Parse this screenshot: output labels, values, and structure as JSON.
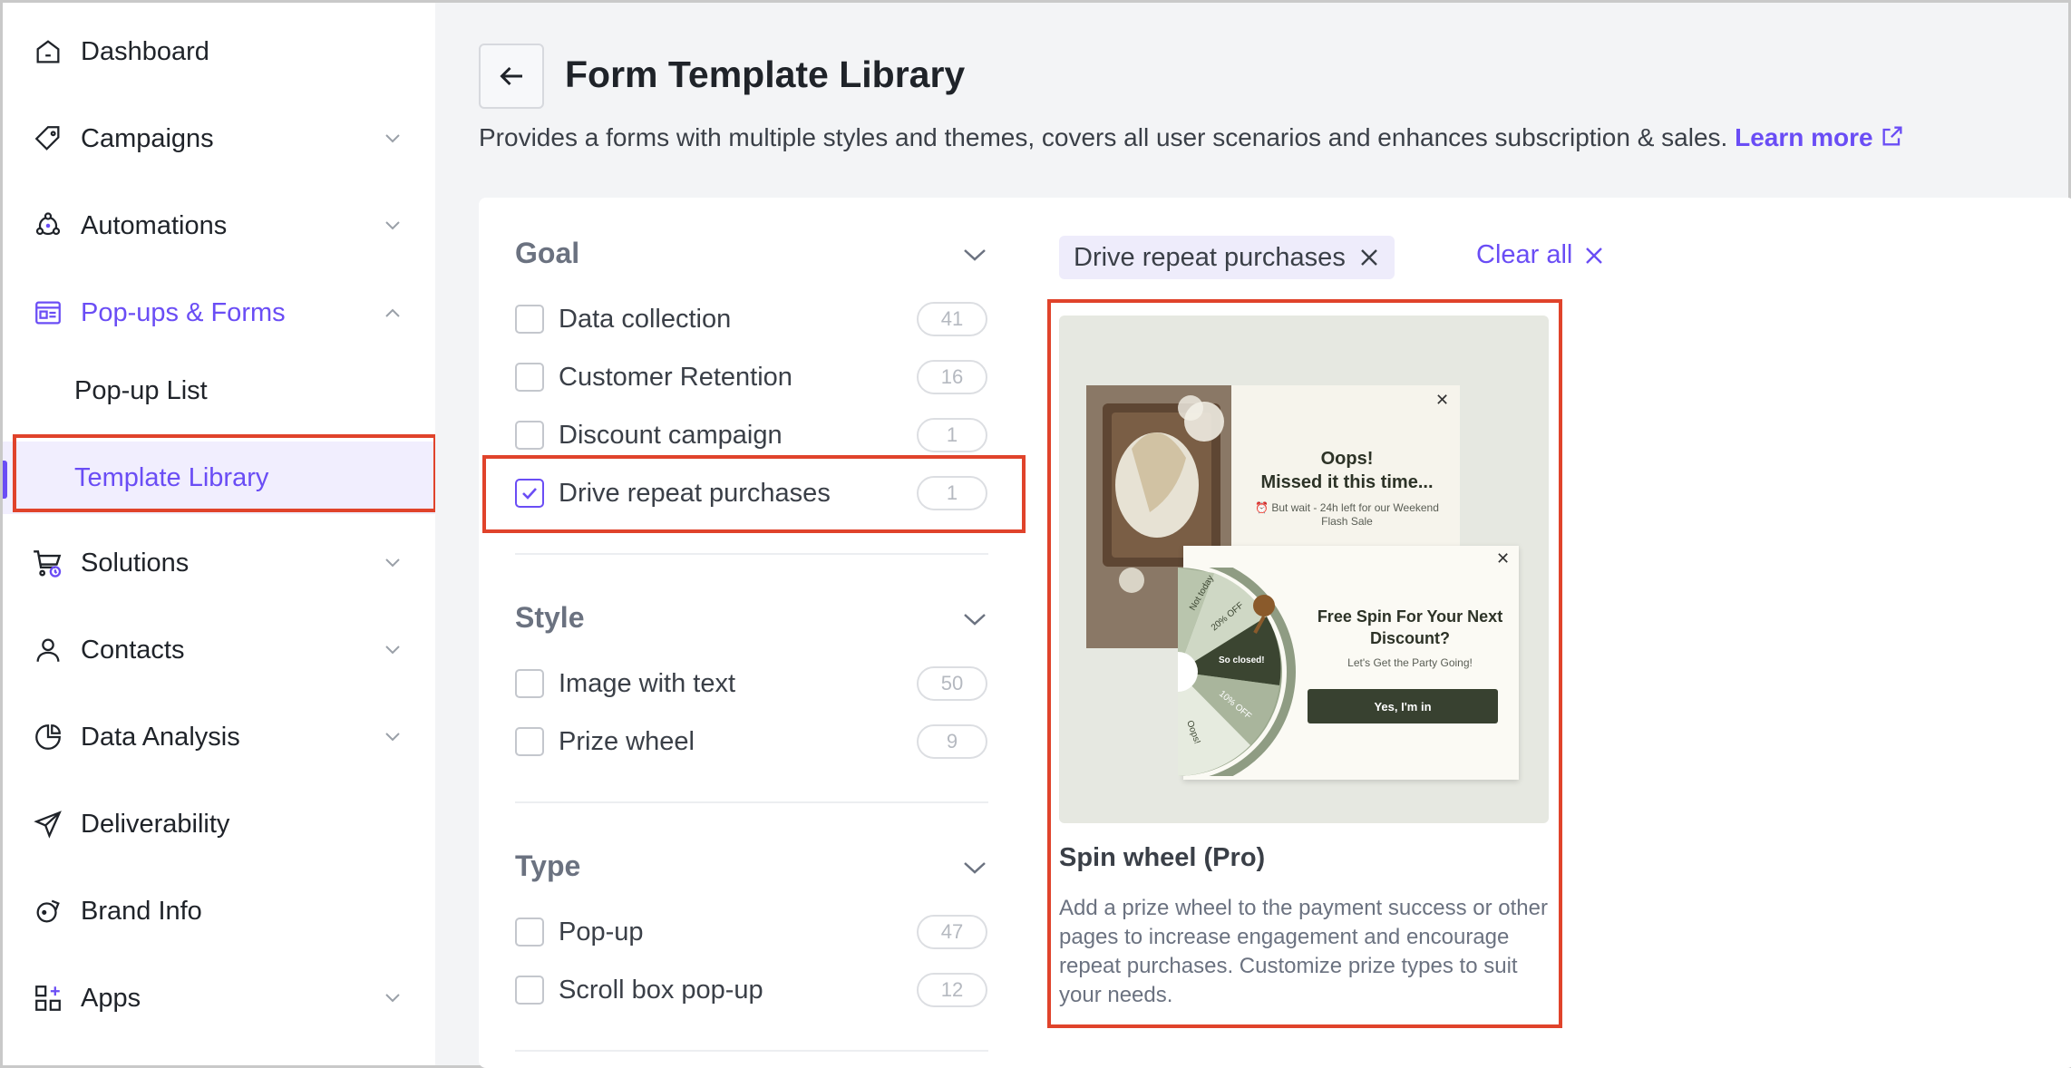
{
  "sidebar": {
    "items": [
      {
        "label": "Dashboard",
        "icon": "home-icon"
      },
      {
        "label": "Campaigns",
        "icon": "tag-icon"
      },
      {
        "label": "Automations",
        "icon": "automation-icon"
      },
      {
        "label": "Pop-ups & Forms",
        "icon": "form-icon"
      },
      {
        "label": "Solutions",
        "icon": "cart-icon"
      },
      {
        "label": "Contacts",
        "icon": "user-icon"
      },
      {
        "label": "Data Analysis",
        "icon": "pie-chart-icon"
      },
      {
        "label": "Deliverability",
        "icon": "send-icon"
      },
      {
        "label": "Brand Info",
        "icon": "brand-icon"
      },
      {
        "label": "Apps",
        "icon": "apps-icon"
      }
    ],
    "sub_items": [
      {
        "label": "Pop-up List"
      },
      {
        "label": "Template Library"
      }
    ]
  },
  "header": {
    "title": "Form Template Library",
    "description": "Provides a forms with multiple styles and themes, covers all user scenarios and enhances subscription & sales.",
    "learn_more": "Learn more"
  },
  "filters": {
    "goal": {
      "title": "Goal",
      "options": [
        {
          "label": "Data collection",
          "count": "41",
          "checked": false
        },
        {
          "label": "Customer Retention",
          "count": "16",
          "checked": false
        },
        {
          "label": "Discount campaign",
          "count": "1",
          "checked": false
        },
        {
          "label": "Drive repeat purchases",
          "count": "1",
          "checked": true
        }
      ]
    },
    "style": {
      "title": "Style",
      "options": [
        {
          "label": "Image with text",
          "count": "50",
          "checked": false
        },
        {
          "label": "Prize wheel",
          "count": "9",
          "checked": false
        }
      ]
    },
    "type": {
      "title": "Type",
      "options": [
        {
          "label": "Pop-up",
          "count": "47",
          "checked": false
        },
        {
          "label": "Scroll box pop-up",
          "count": "12",
          "checked": false
        }
      ]
    }
  },
  "active_filters": {
    "chip": "Drive repeat purchases",
    "clear_all": "Clear all"
  },
  "template": {
    "title": "Spin wheel (Pro)",
    "description": "Add a prize wheel to the payment success or other pages to increase engagement and encourage repeat purchases. Customize prize types to suit your needs.",
    "preview": {
      "popup1_heading": "Oops!\nMissed it this time...",
      "popup1_sub": "⏰ But wait - 24h left for our Weekend Flash Sale",
      "popup2_heading": "Free Spin For Your Next Discount?",
      "popup2_sub": "Let's Get the Party Going!",
      "popup2_button": "Yes, I'm in",
      "wheel_labels": [
        "Not today",
        "20% OFF",
        "So closed!",
        "10% OFF",
        "Oops!"
      ]
    }
  },
  "colors": {
    "accent": "#6a4df5",
    "highlight": "#e0432b"
  }
}
